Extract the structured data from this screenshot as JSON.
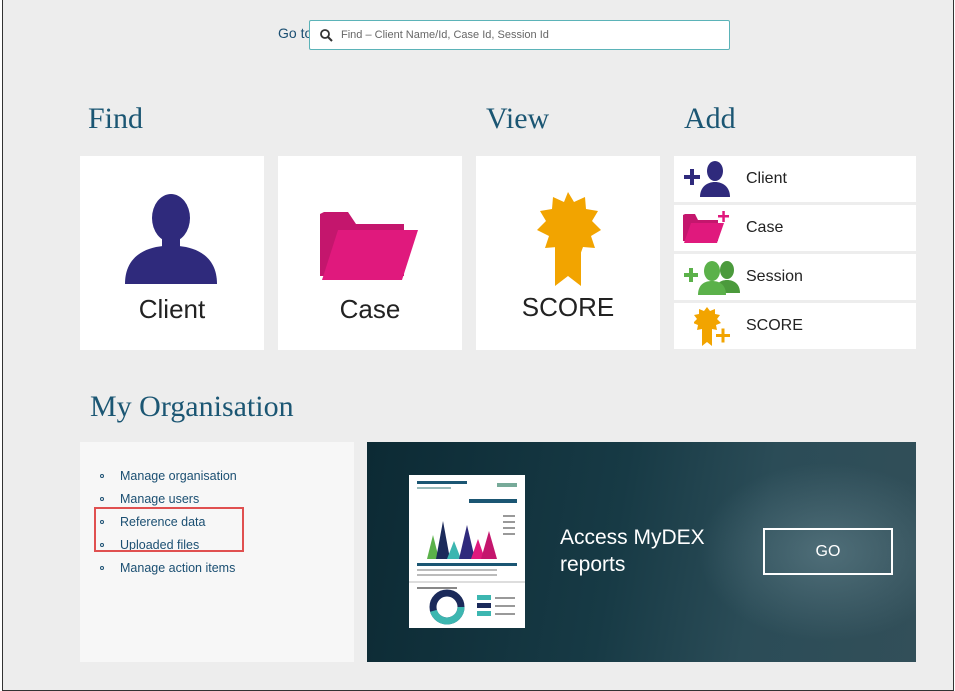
{
  "search": {
    "label": "Go to",
    "placeholder": "Find – Client Name/Id, Case Id, Session Id"
  },
  "sections": {
    "find": "Find",
    "view": "View",
    "add": "Add",
    "org": "My Organisation"
  },
  "find_tiles": [
    {
      "label": "Client",
      "icon": "person-icon"
    },
    {
      "label": "Case",
      "icon": "folder-icon"
    }
  ],
  "view_tiles": [
    {
      "label": "SCORE",
      "icon": "award-icon"
    }
  ],
  "add_items": [
    {
      "label": "Client",
      "icon": "add-client-icon"
    },
    {
      "label": "Case",
      "icon": "add-case-icon"
    },
    {
      "label": "Session",
      "icon": "add-session-icon"
    },
    {
      "label": "SCORE",
      "icon": "add-score-icon"
    }
  ],
  "org_links": [
    "Manage organisation",
    "Manage users",
    "Reference data",
    "Uploaded files",
    "Manage action items"
  ],
  "mydex": {
    "text": "Access MyDEX reports",
    "button": "GO"
  },
  "colors": {
    "title": "#1b5673",
    "client": "#2f2a7c",
    "case": "#e0197d",
    "score": "#f2a400",
    "session": "#5bb14a",
    "highlight": "#e05050"
  }
}
